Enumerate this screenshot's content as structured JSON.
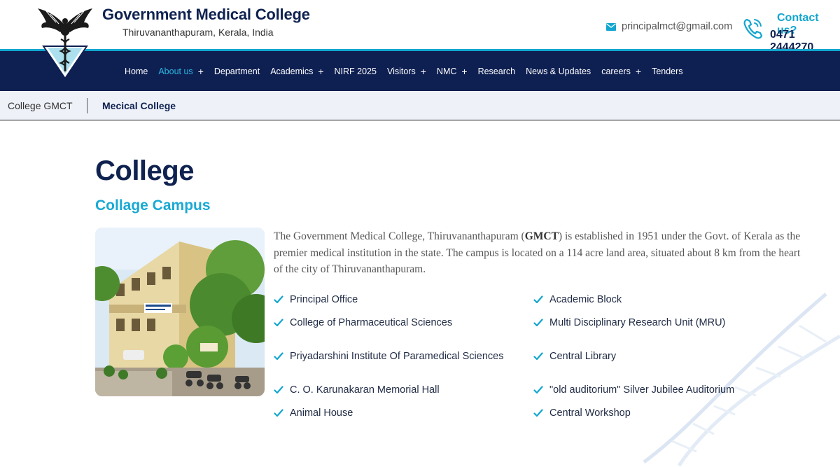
{
  "header": {
    "title": "Government Medical College",
    "subtitle": "Thiruvananthapuram, Kerala, India",
    "email": "principalmct@gmail.com",
    "contact_label": "Contact us?",
    "contact_phone": "0471 2444270",
    "icons": {
      "email": "envelope-icon",
      "phone": "phone-call-icon"
    },
    "colors": {
      "navy": "#0e1f52",
      "accent": "#12a6cf"
    }
  },
  "nav": {
    "items": [
      {
        "label": "Home",
        "has_submenu": false,
        "active": false
      },
      {
        "label": "About us",
        "has_submenu": true,
        "active": true
      },
      {
        "label": "Department",
        "has_submenu": false,
        "active": false
      },
      {
        "label": "Academics",
        "has_submenu": true,
        "active": false
      },
      {
        "label": "NIRF 2025",
        "has_submenu": false,
        "active": false
      },
      {
        "label": "Visitors",
        "has_submenu": true,
        "active": false
      },
      {
        "label": "NMC",
        "has_submenu": true,
        "active": false
      },
      {
        "label": "Research",
        "has_submenu": false,
        "active": false
      },
      {
        "label": "News & Updates",
        "has_submenu": false,
        "active": false
      },
      {
        "label": "careers",
        "has_submenu": true,
        "active": false
      },
      {
        "label": "Tenders",
        "has_submenu": false,
        "active": false
      }
    ],
    "submenu_symbol": "+"
  },
  "breadcrumb": {
    "parent": "College GMCT",
    "current": "Mecical College"
  },
  "main": {
    "title": "College",
    "section_title": "Collage Campus",
    "intro_part1": "The Government Medical College, Thiruvananthapuram (",
    "intro_bold": "GMCT",
    "intro_part2": ") is established in 1951 under the Govt. of Kerala as the premier medical institution in the state.  The campus is located on a 114 acre land area, situated about 8 km from the heart of the city of Thiruvananthapuram.",
    "facilities_left": [
      "Principal Office",
      "College of Pharmaceutical Sciences",
      "Priyadarshini Institute Of Paramedical Sciences",
      "C. O. Karunakaran Memorial Hall",
      "Animal House"
    ],
    "facilities_right": [
      "Academic Block",
      "Multi Disciplinary Research Unit (MRU)",
      "Central Library",
      "\"old auditorium\" Silver Jubilee Auditorium",
      "Central Workshop"
    ],
    "list_icon": "checkmark-icon"
  }
}
